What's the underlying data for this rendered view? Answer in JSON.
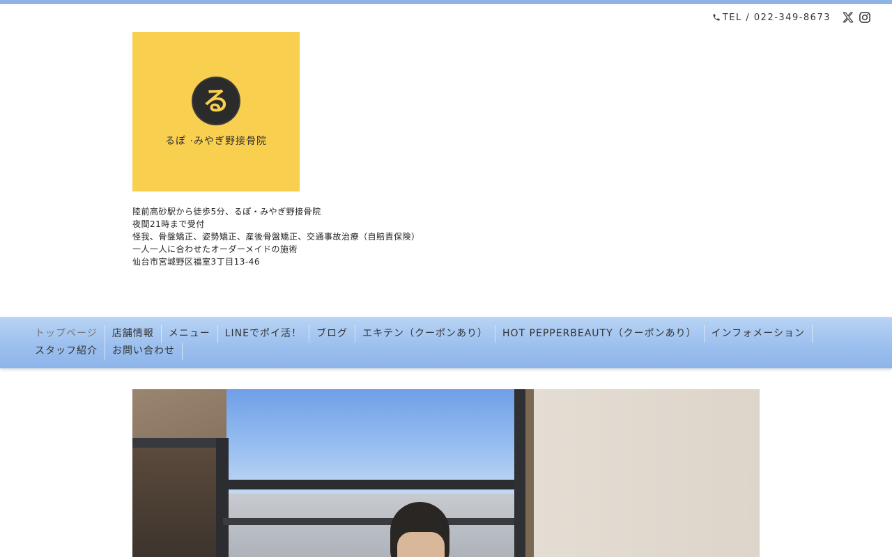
{
  "header": {
    "tel": "TEL / 022-349-8673",
    "social": [
      {
        "icon": "x-icon",
        "name": "X"
      },
      {
        "icon": "instagram-icon",
        "name": "Instagram"
      }
    ]
  },
  "logo": {
    "mark": "る",
    "text": "るぽ ·みやぎ野接骨院"
  },
  "intro": [
    "陸前高砂駅から徒歩5分、るぽ・みやぎ野接骨院",
    "夜間21時まで受付",
    "怪我、骨盤矯正、姿勢矯正、産後骨盤矯正、交通事故治療（自賠責保険）",
    "一人一人に合わせたオーダーメイドの施術",
    "仙台市宮城野区福室3丁目13-46"
  ],
  "nav": {
    "items": [
      {
        "label": "トップページ",
        "active": true
      },
      {
        "label": "店舗情報"
      },
      {
        "label": "メニュー"
      },
      {
        "label": "LINEでポイ活！"
      },
      {
        "label": "ブログ"
      },
      {
        "label": "エキテン（クーポンあり）"
      },
      {
        "label": "HOT PEPPERBEAUTY（クーポンあり）"
      },
      {
        "label": "インフォメーション"
      },
      {
        "label": "スタッフ紹介"
      },
      {
        "label": "お問い合わせ"
      }
    ]
  },
  "colors": {
    "top_strip": "#8fb3e6",
    "logo_bg": "#f8cf4f",
    "nav_bg": "#9cc0ee"
  }
}
